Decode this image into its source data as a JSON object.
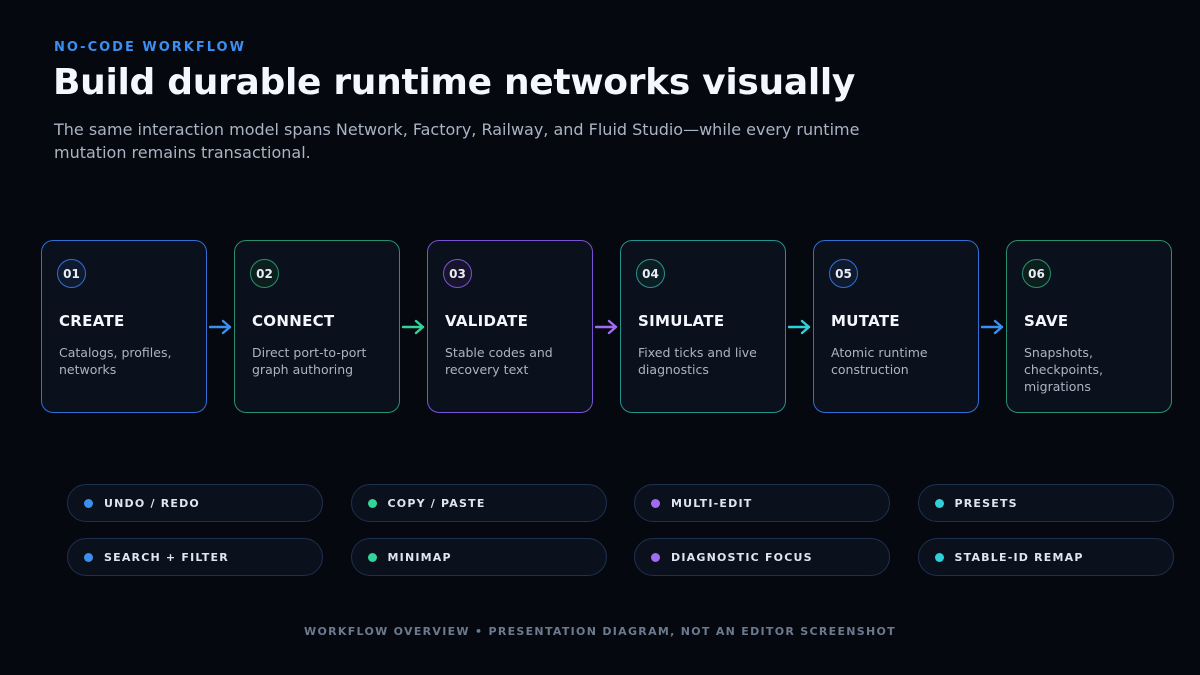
{
  "header": {
    "eyebrow": "NO-CODE WORKFLOW",
    "title": "Build durable runtime networks visually",
    "subtitle": "The same interaction model spans Network, Factory, Railway, and Fluid Studio—while every runtime mutation remains transactional."
  },
  "steps": [
    {
      "num": "01",
      "label": "CREATE",
      "desc": "Catalogs, profiles, networks",
      "color": "#2f6fd6",
      "num_bg": "#0f1a2e"
    },
    {
      "num": "02",
      "label": "CONNECT",
      "desc": "Direct port-to-port graph authoring",
      "color": "#2a8f6e",
      "num_bg": "#0d1f1d"
    },
    {
      "num": "03",
      "label": "VALIDATE",
      "desc": "Stable codes and recovery text",
      "color": "#7a52d6",
      "num_bg": "#17142c"
    },
    {
      "num": "04",
      "label": "SIMULATE",
      "desc": "Fixed ticks and live diagnostics",
      "color": "#23938f",
      "num_bg": "#0c1e22"
    },
    {
      "num": "05",
      "label": "MUTATE",
      "desc": "Atomic runtime construction",
      "color": "#2f6fd6",
      "num_bg": "#0f1a2e"
    },
    {
      "num": "06",
      "label": "SAVE",
      "desc": "Snapshots, checkpoints, migrations",
      "color": "#2a8f6e",
      "num_bg": "#0d1f1d"
    }
  ],
  "arrows": [
    {
      "color": "#3b8ff0"
    },
    {
      "color": "#34d399"
    },
    {
      "color": "#a36bf2"
    },
    {
      "color": "#2fd0d8"
    },
    {
      "color": "#3b8ff0"
    }
  ],
  "chips": [
    {
      "label": "UNDO / REDO",
      "color": "#3b8ff0"
    },
    {
      "label": "COPY / PASTE",
      "color": "#34d399"
    },
    {
      "label": "MULTI-EDIT",
      "color": "#a36bf2"
    },
    {
      "label": "PRESETS",
      "color": "#2fd0d8"
    },
    {
      "label": "SEARCH + FILTER",
      "color": "#3b8ff0"
    },
    {
      "label": "MINIMAP",
      "color": "#34d399"
    },
    {
      "label": "DIAGNOSTIC FOCUS",
      "color": "#a36bf2"
    },
    {
      "label": "STABLE-ID REMAP",
      "color": "#2fd0d8"
    }
  ],
  "footer": "WORKFLOW OVERVIEW • PRESENTATION DIAGRAM, NOT AN EDITOR SCREENSHOT"
}
